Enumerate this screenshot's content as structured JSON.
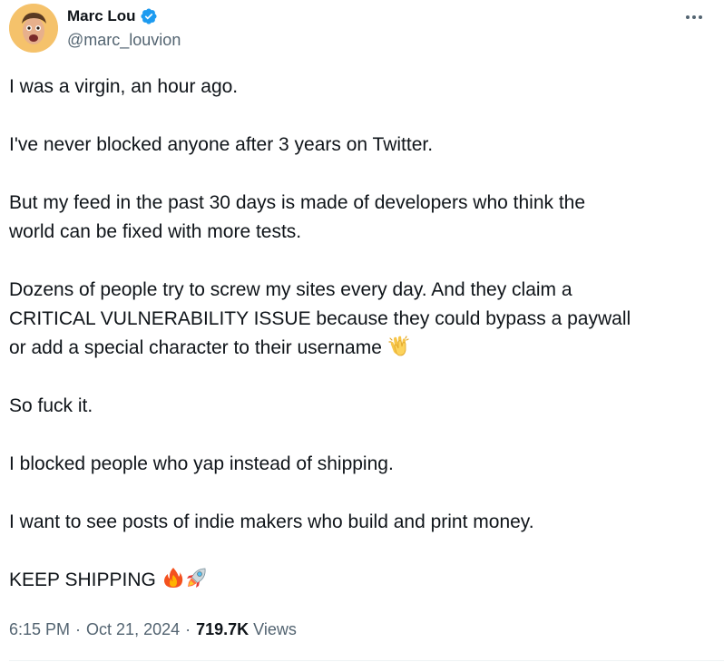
{
  "author": {
    "display_name": "Marc Lou",
    "handle": "@marc_louvion",
    "verified": true
  },
  "icons": {
    "verified": "verified-badge-icon",
    "more": "more-horizontal-icon",
    "clap": "clapping-hands-emoji",
    "fire": "fire-emoji",
    "rocket": "rocket-emoji"
  },
  "colors": {
    "verified_blue": "#1d9bf0",
    "secondary_text": "#536471",
    "primary_text": "#0f1419"
  },
  "tweet": {
    "paragraphs": [
      "I was a virgin, an hour ago.",
      "I've never blocked anyone after 3 years on Twitter.",
      "But my feed in the past 30 days is made of developers who think the\nworld can be fixed with more tests.",
      "Dozens of people try to screw my sites every day. And they claim a\nCRITICAL VULNERABILITY ISSUE because they could bypass a paywall\nor add a special character to their username",
      "So fuck it.",
      "I blocked people who yap instead of shipping.",
      "I want to see posts of indie makers who build and print money.",
      "KEEP SHIPPING"
    ]
  },
  "meta": {
    "time": "6:15 PM",
    "separator": "·",
    "date": "Oct 21, 2024",
    "views_count": "719.7K",
    "views_label": "Views"
  }
}
